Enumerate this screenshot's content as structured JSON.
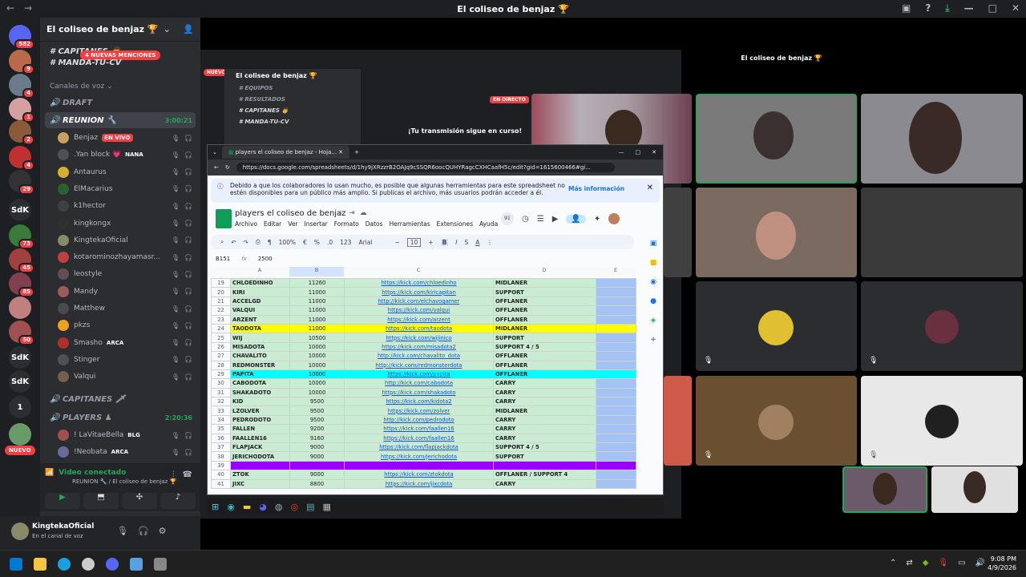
{
  "window": {
    "title": "El coliseo de benjaz 🏆"
  },
  "guilds": [
    {
      "label": "",
      "badge": "582",
      "color": "#5865f2"
    },
    {
      "label": "",
      "badge": "9",
      "color": "#b86a4a"
    },
    {
      "label": "",
      "badge": "4",
      "color": "#6a7b8c"
    },
    {
      "label": "",
      "badge": "1",
      "color": "#d4a0a0"
    },
    {
      "label": "",
      "badge": "2",
      "color": "#8a5a3a"
    },
    {
      "label": "",
      "badge": "4",
      "color": "#c03030"
    },
    {
      "label": "",
      "badge": "29",
      "color": "#333"
    },
    {
      "label": "SdK",
      "badge": "",
      "color": "#2b2d31"
    },
    {
      "label": "",
      "badge": "73",
      "color": "#3a7a3a"
    },
    {
      "label": "",
      "badge": "45",
      "color": "#a04040"
    },
    {
      "label": "",
      "badge": "85",
      "color": "#804050"
    },
    {
      "label": "",
      "badge": "",
      "color": "#c08080"
    },
    {
      "label": "",
      "badge": "50",
      "color": "#a05050"
    },
    {
      "label": "SdK",
      "badge": "",
      "color": "#2b2d31"
    },
    {
      "label": "SdK",
      "badge": "",
      "color": "#2b2d31"
    },
    {
      "label": "1",
      "badge": "",
      "color": "#2b2d31"
    },
    {
      "label": "",
      "badge": "",
      "color": "#6a9a6a"
    }
  ],
  "nuevo_label": "NUEVO",
  "server": {
    "name": "El coliseo de benjaz 🏆",
    "mentions": "4 NUEVAS MENCIONES"
  },
  "channels": {
    "top1": "CAPITANES 👨",
    "top2": "MANDA-TU-CV",
    "voice_category": "Canales de voz",
    "draft": "DRAFT",
    "reunion": "REUNION 🔧",
    "reunion_time": "3:00:21",
    "capitanes_voice": "CAPITANES 🗡",
    "players": "PLAYERS ♟",
    "players_time": "2:20:36"
  },
  "voice_users": [
    {
      "name": "Benjaz",
      "tag": "EN VIVO",
      "color": "#c9a060"
    },
    {
      "name": ".Yan block 💗",
      "tag": "NANA",
      "color": "#505050"
    },
    {
      "name": "Antaurus",
      "tag": "",
      "color": "#d4b030"
    },
    {
      "name": "ElMacarius",
      "tag": "",
      "color": "#2b6030"
    },
    {
      "name": "k1hector",
      "tag": "",
      "color": "#404040"
    },
    {
      "name": "kingkongx",
      "tag": "",
      "color": "#303030"
    },
    {
      "name": "KingtekaOficial",
      "tag": "",
      "color": "#8a8a6a"
    },
    {
      "name": "kotarominozhayamasr...",
      "tag": "",
      "color": "#c04040"
    },
    {
      "name": "leostyle",
      "tag": "",
      "color": "#605050"
    },
    {
      "name": "Mandy",
      "tag": "",
      "color": "#a05a5a"
    },
    {
      "name": "Matthew",
      "tag": "",
      "color": "#4a4a4a"
    },
    {
      "name": "pkzs",
      "tag": "",
      "color": "#f0a020"
    },
    {
      "name": "Smasho",
      "tag": "ARCA",
      "color": "#b03030"
    },
    {
      "name": "Stinger",
      "tag": "",
      "color": "#505050"
    },
    {
      "name": "Valqui",
      "tag": "",
      "color": "#706050"
    }
  ],
  "players_users": [
    {
      "name": "! LaVitaeBella",
      "tag": "BLG",
      "color": "#a05050"
    },
    {
      "name": "!Neobata",
      "tag": "ARCA",
      "color": "#6a6a9a"
    }
  ],
  "voice_panel": {
    "status": "Video conectado",
    "sub": "REUNION 🔧 / El coliseo de benjaz 🏆"
  },
  "user_panel": {
    "name": "KingtekaOficial",
    "status": "En el canal de voz"
  },
  "inner": {
    "title": "El coliseo de benjaz 🏆",
    "server": "El coliseo de benjaz 🏆",
    "channels": [
      "EQUIPOS",
      "RESULTADOS",
      "CAPITANES 👨",
      "MANDA-TU-CV"
    ],
    "nuevo": "NUEVO",
    "live_badge": "EN DIRECTO",
    "stream_msg": "¡Tu transmisión sigue en curso!"
  },
  "sheets": {
    "tab_title": "players el coliseo de benjaz - Hoja...",
    "url": "https://docs.google.com/spreadsheets/d/1hy9jXRzzrB2OAJq9cSSQR6oocQUHYRagcCXHCaafH5c/edit?gid=1615600466#gi...",
    "notice": "Debido a que los colaboradores lo usan mucho, es posible que algunas herramientas para este spreadsheet no estén disponibles para un público más amplio. Si publicas el archivo, más usuarios podrán acceder a él.",
    "notice_link": "Más información",
    "doc_title": "players el coliseo de benjaz",
    "menus": [
      "Archivo",
      "Editar",
      "Ver",
      "Insertar",
      "Formato",
      "Datos",
      "Herramientas",
      "Extensiones",
      "Ayuda"
    ],
    "zoom": "100%",
    "font": "Arial",
    "font_size": "10",
    "cell_ref": "B151",
    "formula": "2500",
    "cols": [
      "A",
      "B",
      "C",
      "D",
      "E"
    ],
    "rows": [
      {
        "n": "19",
        "a": "CHLOEDINHO",
        "b": "11260",
        "c": "https://kick.com/chloedinho",
        "d": "MIDLANER",
        "hl": ""
      },
      {
        "n": "20",
        "a": "KIRI",
        "b": "11000",
        "c": "https://kick.com/kiricapitan",
        "d": "SUPPORT",
        "hl": ""
      },
      {
        "n": "21",
        "a": "ACCELGD",
        "b": "11000",
        "c": "http://kick.com/elchavogamer",
        "d": "OFFLANER",
        "hl": ""
      },
      {
        "n": "22",
        "a": "VALQUI",
        "b": "11000",
        "c": "https://kick.com/valqui",
        "d": "OFFLANER",
        "hl": ""
      },
      {
        "n": "23",
        "a": "ARZENT",
        "b": "11000",
        "c": "https://kick.com/arzent",
        "d": "OFFLANER",
        "hl": ""
      },
      {
        "n": "24",
        "a": "TAODOTA",
        "b": "11000",
        "c": "https://kick.com/taodota",
        "d": "MIDLANER",
        "hl": "#ffff00"
      },
      {
        "n": "25",
        "a": "WIJ",
        "b": "10500",
        "c": "https://kick.com/wijinico",
        "d": "SUPPORT",
        "hl": ""
      },
      {
        "n": "26",
        "a": "MISADOTA",
        "b": "10000",
        "c": "https://kick.com/misadota2",
        "d": "SUPPORT 4 / 5",
        "hl": ""
      },
      {
        "n": "27",
        "a": "CHAVALITO",
        "b": "10000",
        "c": "http://kick.com/chavalito_dota",
        "d": "OFFLANER",
        "hl": ""
      },
      {
        "n": "28",
        "a": "REDMONSTER",
        "b": "10000",
        "c": "http://kick.com/redmonsterdota",
        "d": "OFFLANER",
        "hl": ""
      },
      {
        "n": "29",
        "a": "PAPITA",
        "b": "10000",
        "c": "https://kick.com/papita",
        "d": "OFFLANER",
        "hl": "#00ffff"
      },
      {
        "n": "30",
        "a": "CABODOTA",
        "b": "10000",
        "c": "http://kick.com/cabodota",
        "d": "CARRY",
        "hl": ""
      },
      {
        "n": "31",
        "a": "SHAKADOTO",
        "b": "10000",
        "c": "https://kick.com/shakadoto",
        "d": "CARRY",
        "hl": ""
      },
      {
        "n": "32",
        "a": "KID",
        "b": "9500",
        "c": "https://kick.com/kidota2",
        "d": "CARRY",
        "hl": ""
      },
      {
        "n": "33",
        "a": "LZOLVER",
        "b": "9500",
        "c": "https://kick.com/zolver",
        "d": "MIDLANER",
        "hl": ""
      },
      {
        "n": "34",
        "a": "PEDRODOTO",
        "b": "9500",
        "c": "http://kick.com/pedrodoto",
        "d": "CARRY",
        "hl": ""
      },
      {
        "n": "35",
        "a": "FALLEN",
        "b": "9200",
        "c": "https://kick.com/faallen16",
        "d": "CARRY",
        "hl": ""
      },
      {
        "n": "36",
        "a": "FAALLEN16",
        "b": "9160",
        "c": "https://kick.com/faallen16",
        "d": "CARRY",
        "hl": ""
      },
      {
        "n": "37",
        "a": "FLAPJACK",
        "b": "9000",
        "c": "https://kick.com/flapjackdota",
        "d": "SUPPORT 4 / 5",
        "hl": ""
      },
      {
        "n": "38",
        "a": "JERICHODOTA",
        "b": "9000",
        "c": "https://kick.com/jerichodota",
        "d": "SUPPORT",
        "hl": ""
      },
      {
        "n": "39",
        "a": "",
        "b": "",
        "c": "",
        "d": "",
        "hl": "#9900ff"
      },
      {
        "n": "40",
        "a": "ZTOK",
        "b": "9000",
        "c": "https://kick.com/ztokdota",
        "d": "OFFLANER / SUPPORT 4",
        "hl": ""
      },
      {
        "n": "41",
        "a": "JIXC",
        "b": "8800",
        "c": "https://kick.com/jixcdota",
        "d": "CARRY",
        "hl": ""
      }
    ]
  },
  "clock": {
    "time": "9:08 PM",
    "date": "4/9/2026"
  }
}
